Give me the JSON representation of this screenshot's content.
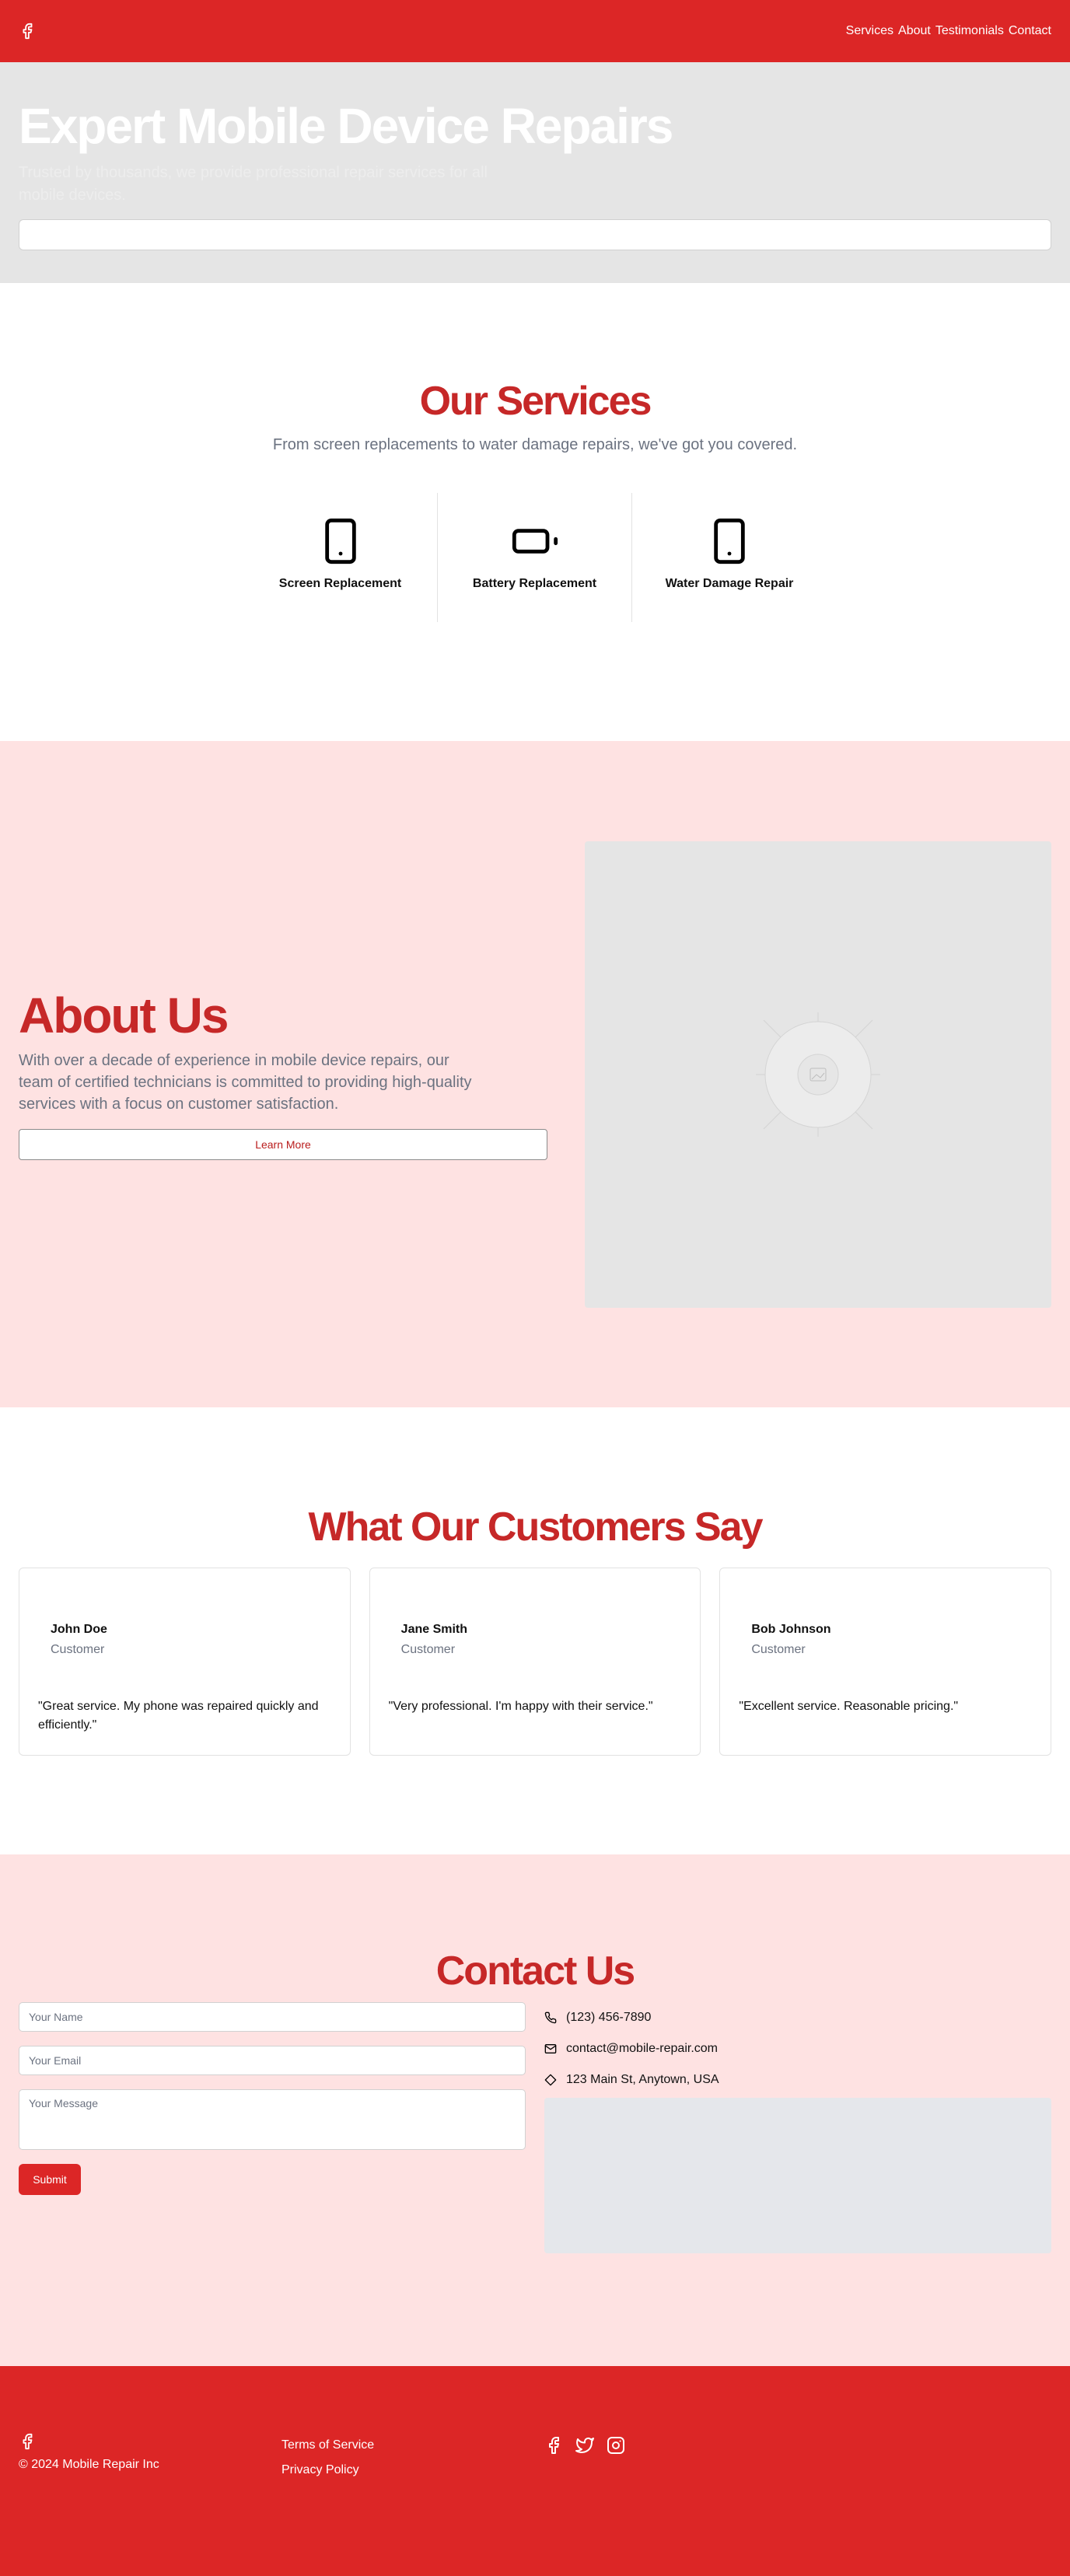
{
  "colors": {
    "brand": "#dc2626",
    "heading": "#c62828",
    "soft": "#fee2e2",
    "muted": "#6b7280"
  },
  "header": {
    "logo_icon": "facebook-icon",
    "nav": [
      "Services",
      "About",
      "Testimonials",
      "Contact"
    ]
  },
  "hero": {
    "title": "Expert Mobile Device Repairs",
    "subtitle": "Trusted by thousands, we provide professional repair services for all mobile devices.",
    "input_value": ""
  },
  "services": {
    "title": "Our Services",
    "subtitle": "From screen replacements to water damage repairs, we've got you covered.",
    "items": [
      {
        "label": "Screen Replacement",
        "icon": "smartphone-icon"
      },
      {
        "label": "Battery Replacement",
        "icon": "battery-icon"
      },
      {
        "label": "Water Damage Repair",
        "icon": "smartphone-icon"
      }
    ]
  },
  "about": {
    "title": "About Us",
    "text": "With over a decade of experience in mobile device repairs, our team of certified technicians is committed to providing high-quality services with a focus on customer satisfaction.",
    "button": "Learn More",
    "image_icon": "image-placeholder-icon"
  },
  "testimonials": {
    "title": "What Our Customers Say",
    "items": [
      {
        "name": "John Doe",
        "role": "Customer",
        "quote": "\"Great service. My phone was repaired quickly and efficiently.\""
      },
      {
        "name": "Jane Smith",
        "role": "Customer",
        "quote": "\"Very professional. I'm happy with their service.\""
      },
      {
        "name": "Bob Johnson",
        "role": "Customer",
        "quote": "\"Excellent service. Reasonable pricing.\""
      }
    ]
  },
  "contact": {
    "title": "Contact Us",
    "placeholders": {
      "name": "Your Name",
      "email": "Your Email",
      "message": "Your Message"
    },
    "submit": "Submit",
    "phone": "(123) 456-7890",
    "email": "contact@mobile-repair.com",
    "address": "123 Main St, Anytown, USA"
  },
  "footer": {
    "copyright": "© 2024 Mobile Repair Inc",
    "links": [
      "Terms of Service",
      "Privacy Policy"
    ],
    "social_icons": [
      "facebook-icon",
      "twitter-icon",
      "instagram-icon"
    ]
  }
}
